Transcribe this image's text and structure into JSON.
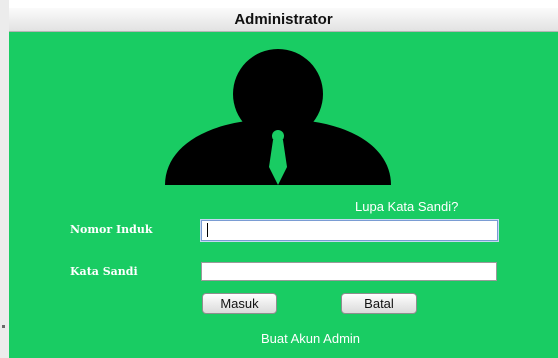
{
  "window": {
    "title": "Administrator"
  },
  "login": {
    "forgot_link": "Lupa Kata Sandi?",
    "id_label": "Nomor Induk",
    "id_value": "",
    "password_label": "Kata Sandi",
    "password_value": "",
    "login_button": "Masuk",
    "cancel_button": "Batal",
    "create_account_link": "Buat Akun Admin"
  },
  "colors": {
    "panel_background": "#19cc63",
    "avatar_fill": "#000000",
    "tie_fill": "#19cc63",
    "link_text": "#ffffff"
  },
  "icons": {
    "avatar": "admin-user-icon"
  }
}
